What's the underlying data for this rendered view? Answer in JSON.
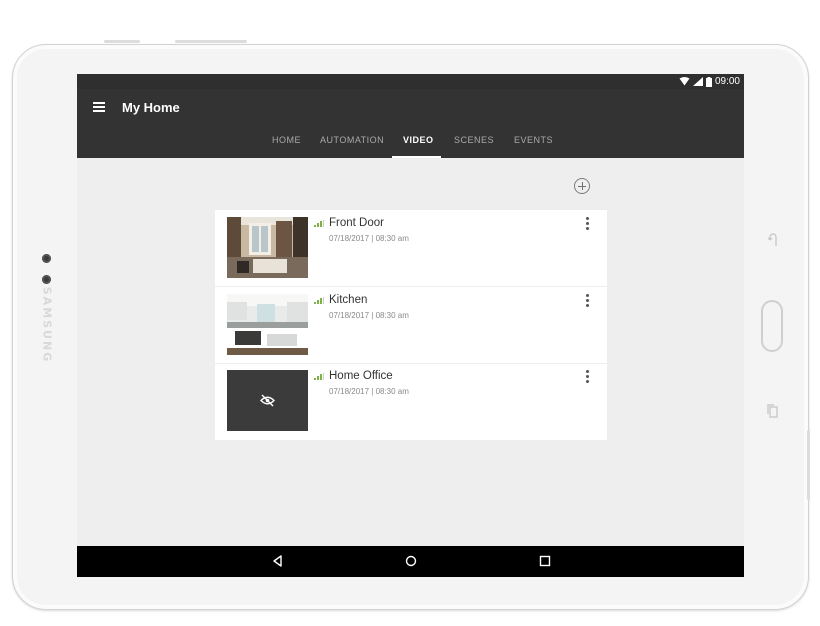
{
  "device": {
    "brand": "SAMSUNG"
  },
  "status_bar": {
    "time": "09:00"
  },
  "app_bar": {
    "title": "My Home",
    "tabs": [
      {
        "label": "HOME",
        "active": false
      },
      {
        "label": "AUTOMATION",
        "active": false
      },
      {
        "label": "VIDEO",
        "active": true
      },
      {
        "label": "SCENES",
        "active": false
      },
      {
        "label": "EVENTS",
        "active": false
      }
    ]
  },
  "cameras": [
    {
      "name": "Front Door",
      "timestamp": "07/18/2017 | 08:30 am",
      "thumbnail": "front-door-snapshot",
      "hidden": false
    },
    {
      "name": "Kitchen",
      "timestamp": "07/18/2017 | 08:30 am",
      "thumbnail": "kitchen-snapshot",
      "hidden": false
    },
    {
      "name": "Home Office",
      "timestamp": "07/18/2017 | 08:30 am",
      "thumbnail": "eye-off-icon",
      "hidden": true
    }
  ],
  "icons": {
    "menu": "hamburger-menu-icon",
    "add": "add-circle-icon",
    "signal": "signal-strength-icon",
    "more": "more-vert-icon",
    "back": "back-triangle-icon",
    "home": "home-circle-icon",
    "recents": "recents-square-icon"
  },
  "colors": {
    "app_bar": "#333333",
    "status_bar": "#2f2f2f",
    "background": "#eeeeee",
    "signal_green": "#7cb342",
    "nav_bar": "#000000"
  }
}
